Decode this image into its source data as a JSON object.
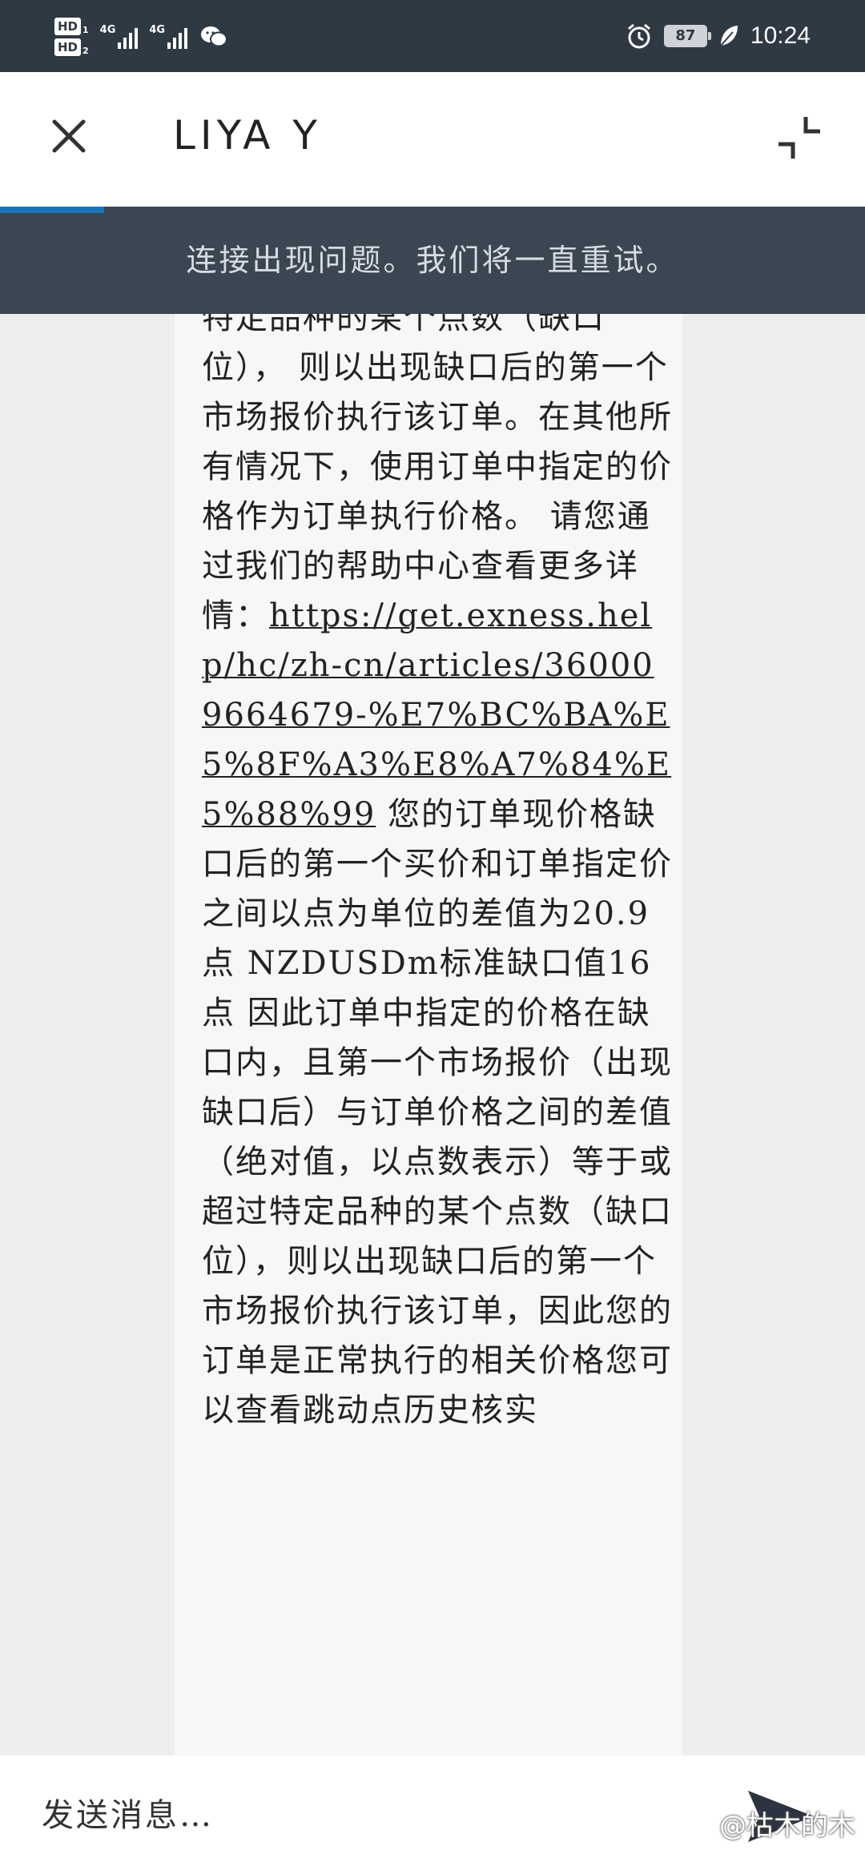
{
  "status_bar": {
    "sim1": "HD",
    "sim1_num": "1",
    "sim2": "HD",
    "sim2_num": "2",
    "net1": "4G",
    "net2": "4G",
    "battery": "87",
    "time": "10:24",
    "icons": [
      "signal-icon",
      "wechat-icon",
      "alarm-icon",
      "battery-icon",
      "leaf-icon"
    ]
  },
  "header": {
    "title": "LIYA Y",
    "close_icon": "close-icon",
    "collapse_icon": "collapse-icon"
  },
  "banner": {
    "text": "连接出现问题。我们将一直重试。",
    "progress": 0.12,
    "progress_color": "#1b75bc"
  },
  "message": {
    "before_link": "特定品种的某个点数（缺口位）， 则以出现缺口后的第一个市场报价执行该订单。在其他所有情况下，使用订单中指定的价格作为订单执行价格。 请您通过我们的帮助中心查看更多详情：",
    "link": "https://get.exness.help/hc/zh-cn/articles/360009664679-%E7%BC%BA%E5%8F%A3%E8%A7%84%E5%88%99",
    "after_link": " 您的订单现价格缺口后的第一个买价和订单指定价之间以点为单位的差值为20.9点 NZDUSDm标准缺口值16点 因此订单中指定的价格在缺口内，且第一个市场报价（出现缺口后）与订单价格之间的差值（绝对值，以点数表示）等于或超过特定品种的某个点数（缺口位），则以出现缺口后的第一个市场报价执行该订单，因此您的订单是正常执行的相关价格您可以查看跳动点历史核实"
  },
  "composer": {
    "placeholder": "发送消息…",
    "send_icon": "send-icon",
    "watermark": "@枯木的木"
  },
  "colors": {
    "status_bar": "#2f3944",
    "banner": "#3b4652",
    "background": "#eeeeee"
  }
}
